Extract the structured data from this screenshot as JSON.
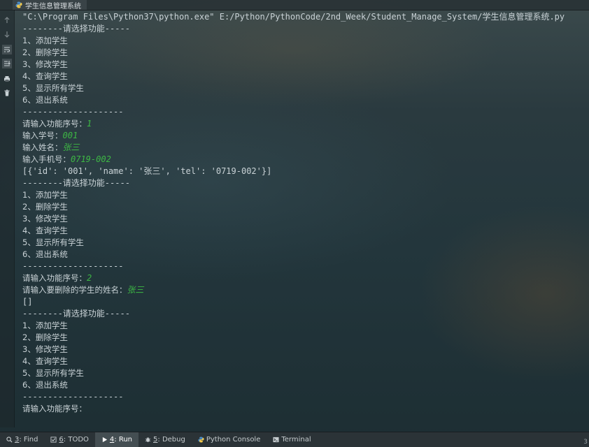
{
  "tab": {
    "title": "学生信息管理系统"
  },
  "console": {
    "path_line": "\"C:\\Program Files\\Python37\\python.exe\" E:/Python/PythonCode/2nd_Week/Student_Manage_System/学生信息管理系统.py",
    "lines": [
      {
        "type": "text",
        "text": "--------请选择功能-----"
      },
      {
        "type": "text",
        "text": "1、添加学生"
      },
      {
        "type": "text",
        "text": "2、删除学生"
      },
      {
        "type": "text",
        "text": "3、修改学生"
      },
      {
        "type": "text",
        "text": "4、查询学生"
      },
      {
        "type": "text",
        "text": "5、显示所有学生"
      },
      {
        "type": "text",
        "text": "6、退出系统"
      },
      {
        "type": "text",
        "text": "--------------------"
      },
      {
        "type": "prompt",
        "text": "请输入功能序号：",
        "input": "1"
      },
      {
        "type": "prompt",
        "text": "输入学号：",
        "input": "001"
      },
      {
        "type": "prompt",
        "text": "输入姓名：",
        "input": "张三"
      },
      {
        "type": "prompt",
        "text": "输入手机号：",
        "input": "0719-002"
      },
      {
        "type": "text",
        "text": "[{'id': '001', 'name': '张三', 'tel': '0719-002'}]"
      },
      {
        "type": "text",
        "text": "--------请选择功能-----"
      },
      {
        "type": "text",
        "text": "1、添加学生"
      },
      {
        "type": "text",
        "text": "2、删除学生"
      },
      {
        "type": "text",
        "text": "3、修改学生"
      },
      {
        "type": "text",
        "text": "4、查询学生"
      },
      {
        "type": "text",
        "text": "5、显示所有学生"
      },
      {
        "type": "text",
        "text": "6、退出系统"
      },
      {
        "type": "text",
        "text": "--------------------"
      },
      {
        "type": "prompt",
        "text": "请输入功能序号：",
        "input": "2"
      },
      {
        "type": "prompt",
        "text": "请输入要删除的学生的姓名：",
        "input": "张三"
      },
      {
        "type": "text",
        "text": "[]"
      },
      {
        "type": "text",
        "text": "--------请选择功能-----"
      },
      {
        "type": "text",
        "text": "1、添加学生"
      },
      {
        "type": "text",
        "text": "2、删除学生"
      },
      {
        "type": "text",
        "text": "3、修改学生"
      },
      {
        "type": "text",
        "text": "4、查询学生"
      },
      {
        "type": "text",
        "text": "5、显示所有学生"
      },
      {
        "type": "text",
        "text": "6、退出系统"
      },
      {
        "type": "text",
        "text": "--------------------"
      },
      {
        "type": "prompt",
        "text": "请输入功能序号：",
        "input": ""
      }
    ]
  },
  "gutter": {
    "icons": [
      "up-arrow-icon",
      "down-arrow-icon",
      "soft-wrap-icon",
      "scroll-to-end-icon",
      "print-icon",
      "trash-icon"
    ]
  },
  "statusbar": {
    "items": [
      {
        "num": "3",
        "label": ": Find",
        "icon": "find-icon",
        "active": false
      },
      {
        "num": "6",
        "label": ": TODO",
        "icon": "todo-icon",
        "active": false
      },
      {
        "num": "4",
        "label": ": Run",
        "icon": "run-icon",
        "active": true
      },
      {
        "num": "5",
        "label": ": Debug",
        "icon": "debug-icon",
        "active": false
      },
      {
        "num": "",
        "label": "Python Console",
        "icon": "python-console-icon",
        "active": false
      },
      {
        "num": "",
        "label": "Terminal",
        "icon": "terminal-icon",
        "active": false
      }
    ],
    "corner": "3"
  },
  "colors": {
    "input_text": "#3db844",
    "console_text": "#c9d2d6"
  }
}
